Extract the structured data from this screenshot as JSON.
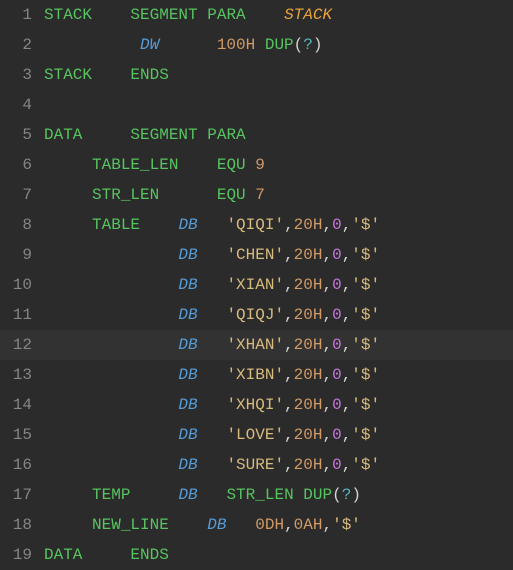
{
  "lines": [
    {
      "num": "1",
      "html": "<span class='kw'>STACK</span>    <span class='kw'>SEGMENT</span> <span class='kw'>PARA</span>    <span class='stackit'>STACK</span>"
    },
    {
      "num": "2",
      "html": "          <span class='type'>DW</span>      <span class='num'>100H</span> <span class='kw'>DUP</span><span class='punct'>(</span><span class='op'>?</span><span class='punct'>)</span>"
    },
    {
      "num": "3",
      "html": "<span class='kw'>STACK</span>    <span class='kw'>ENDS</span>"
    },
    {
      "num": "4",
      "html": ""
    },
    {
      "num": "5",
      "html": "<span class='kw'>DATA</span>     <span class='kw'>SEGMENT</span> <span class='kw'>PARA</span>"
    },
    {
      "num": "6",
      "html": "     <span class='ident'>TABLE_LEN</span>    <span class='kw'>EQU</span> <span class='num'>9</span>"
    },
    {
      "num": "7",
      "html": "     <span class='ident'>STR_LEN</span>      <span class='kw'>EQU</span> <span class='num'>7</span>"
    },
    {
      "num": "8",
      "html": "     <span class='ident'>TABLE</span>    <span class='type'>DB</span>   <span class='str'>'QIQI'</span><span class='punct'>,</span><span class='num'>20H</span><span class='punct'>,</span><span class='zero'>0</span><span class='punct'>,</span><span class='str'>'$'</span>"
    },
    {
      "num": "9",
      "html": "              <span class='type'>DB</span>   <span class='str'>'CHEN'</span><span class='punct'>,</span><span class='num'>20H</span><span class='punct'>,</span><span class='zero'>0</span><span class='punct'>,</span><span class='str'>'$'</span>"
    },
    {
      "num": "10",
      "html": "              <span class='type'>DB</span>   <span class='str'>'XIAN'</span><span class='punct'>,</span><span class='num'>20H</span><span class='punct'>,</span><span class='zero'>0</span><span class='punct'>,</span><span class='str'>'$'</span>"
    },
    {
      "num": "11",
      "html": "              <span class='type'>DB</span>   <span class='str'>'QIQJ'</span><span class='punct'>,</span><span class='num'>20H</span><span class='punct'>,</span><span class='zero'>0</span><span class='punct'>,</span><span class='str'>'$'</span>"
    },
    {
      "num": "12",
      "html": "              <span class='type'>DB</span>   <span class='str'>'XHAN'</span><span class='punct'>,</span><span class='num'>20H</span><span class='punct'>,</span><span class='zero'>0</span><span class='punct'>,</span><span class='str'>'$'</span>",
      "current": true
    },
    {
      "num": "13",
      "html": "              <span class='type'>DB</span>   <span class='str'>'XIBN'</span><span class='punct'>,</span><span class='num'>20H</span><span class='punct'>,</span><span class='zero'>0</span><span class='punct'>,</span><span class='str'>'$'</span>"
    },
    {
      "num": "14",
      "html": "              <span class='type'>DB</span>   <span class='str'>'XHQI'</span><span class='punct'>,</span><span class='num'>20H</span><span class='punct'>,</span><span class='zero'>0</span><span class='punct'>,</span><span class='str'>'$'</span>"
    },
    {
      "num": "15",
      "html": "              <span class='type'>DB</span>   <span class='str'>'LOVE'</span><span class='punct'>,</span><span class='num'>20H</span><span class='punct'>,</span><span class='zero'>0</span><span class='punct'>,</span><span class='str'>'$'</span>"
    },
    {
      "num": "16",
      "html": "              <span class='type'>DB</span>   <span class='str'>'SURE'</span><span class='punct'>,</span><span class='num'>20H</span><span class='punct'>,</span><span class='zero'>0</span><span class='punct'>,</span><span class='str'>'$'</span>"
    },
    {
      "num": "17",
      "html": "     <span class='ident'>TEMP</span>     <span class='type'>DB</span>   <span class='ident'>STR_LEN</span> <span class='kw'>DUP</span><span class='punct'>(</span><span class='op'>?</span><span class='punct'>)</span>"
    },
    {
      "num": "18",
      "html": "     <span class='ident'>NEW_LINE</span>    <span class='type'>DB</span>   <span class='num'>0DH</span><span class='punct'>,</span><span class='num'>0AH</span><span class='punct'>,</span><span class='str'>'$'</span>"
    },
    {
      "num": "19",
      "html": "<span class='kw'>DATA</span>     <span class='kw'>ENDS</span>"
    }
  ]
}
